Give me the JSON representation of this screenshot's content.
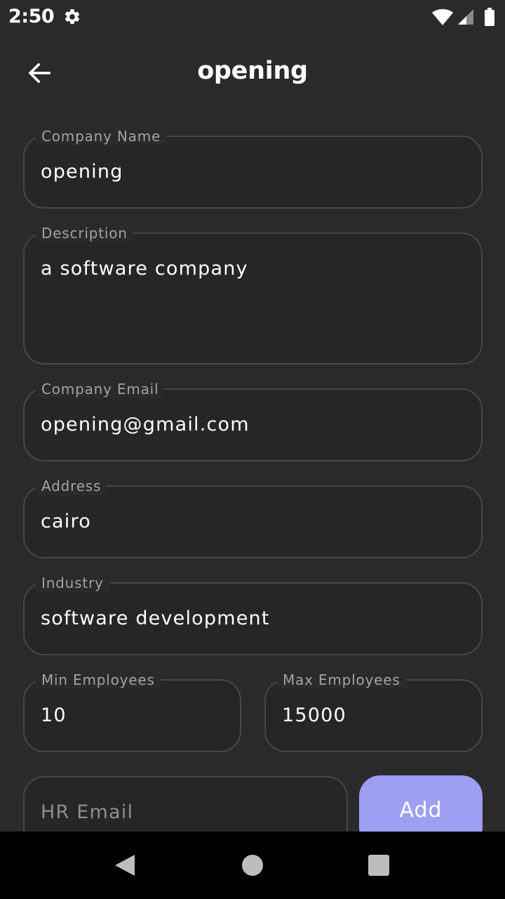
{
  "status_bar": {
    "time": "2:50",
    "icons": [
      "gear-icon",
      "wifi-icon",
      "signal-icon",
      "battery-icon"
    ]
  },
  "app_bar": {
    "title": "opening",
    "back_icon": "arrow-left-icon"
  },
  "form": {
    "company_name": {
      "label": "Company Name",
      "value": "opening"
    },
    "description": {
      "label": "Description",
      "value": "a software company"
    },
    "company_email": {
      "label": "Company Email",
      "value": "opening@gmail.com"
    },
    "address": {
      "label": "Address",
      "value": "cairo"
    },
    "industry": {
      "label": "Industry",
      "value": "software development"
    },
    "min_employees": {
      "label": "Min Employees",
      "value": "10"
    },
    "max_employees": {
      "label": "Max Employees",
      "value": "15000"
    },
    "hr_email": {
      "placeholder": "HR Email",
      "value": ""
    },
    "add_label": "Add"
  },
  "nav_bar": {
    "icons": [
      "nav-back-icon",
      "nav-home-icon",
      "nav-recents-icon"
    ]
  },
  "colors": {
    "background": "#2a2a2a",
    "field_background": "#262626",
    "field_border": "#474747",
    "label": "#a3a3a3",
    "accent": "#9e9ef2",
    "nav_bar": "#000000"
  }
}
